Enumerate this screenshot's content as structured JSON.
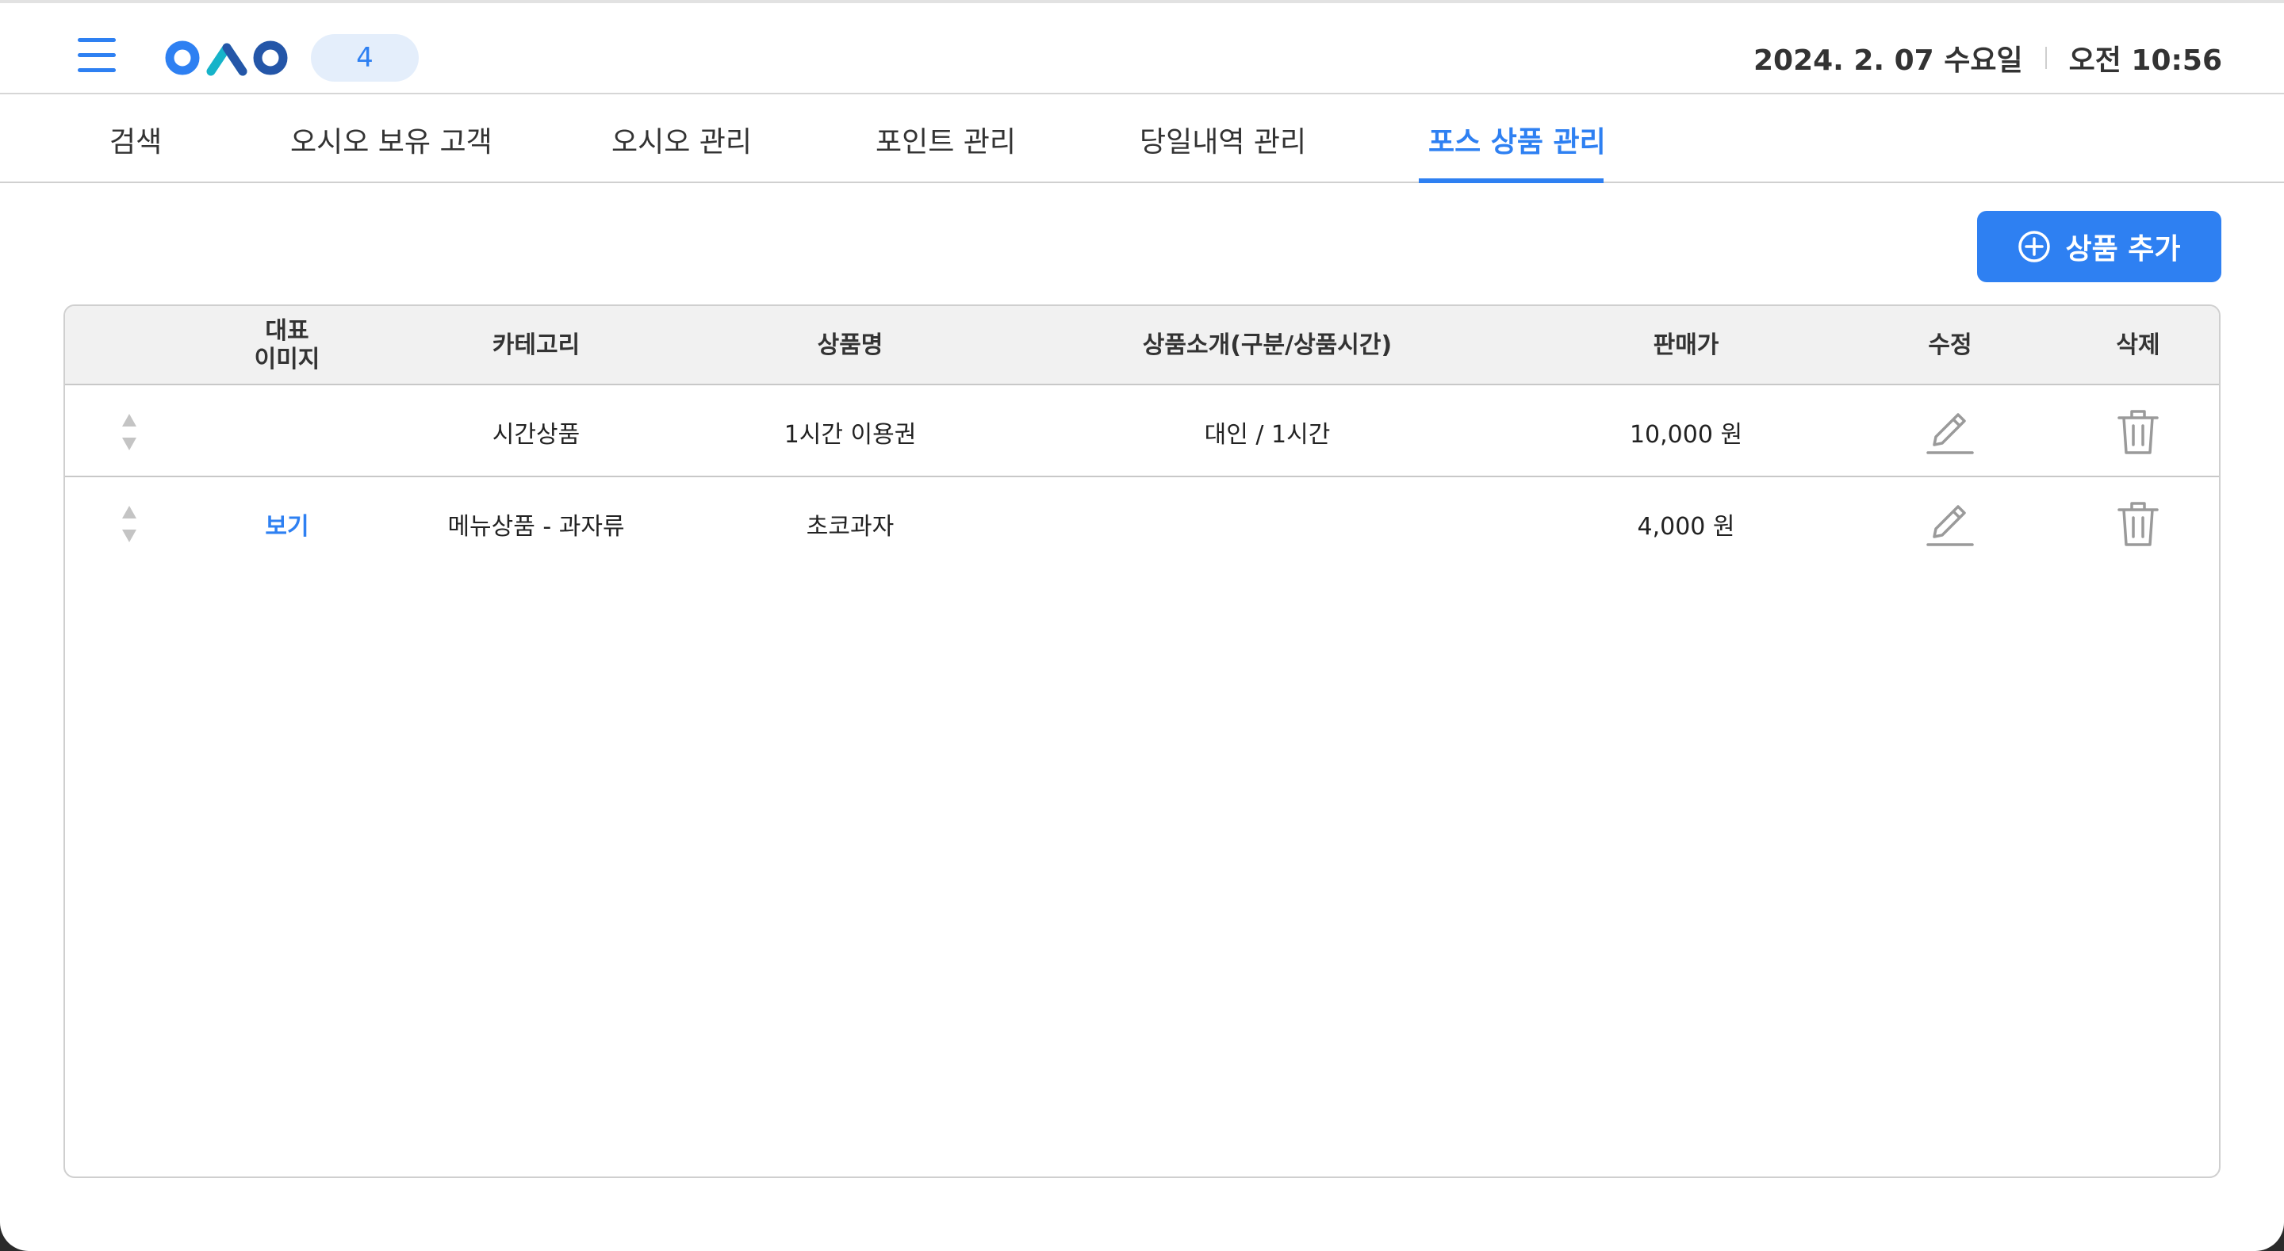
{
  "header": {
    "badge": "4",
    "date": "2024. 2. 07 수요일",
    "time": "오전 10:56",
    "logo_colors": [
      "#2e80f2",
      "#16b3c9",
      "#2456a8"
    ]
  },
  "tabs": [
    {
      "label": "검색"
    },
    {
      "label": "오시오 보유 고객"
    },
    {
      "label": "오시오 관리"
    },
    {
      "label": "포인트 관리"
    },
    {
      "label": "당일내역 관리"
    },
    {
      "label": "포스 상품 관리",
      "active": true
    }
  ],
  "toolbar": {
    "add_label": "상품 추가"
  },
  "table": {
    "headers": {
      "image_line1": "대표",
      "image_line2": "이미지",
      "category": "카테고리",
      "name": "상품명",
      "intro": "상품소개(구분/상품시간)",
      "price": "판매가",
      "edit": "수정",
      "delete": "삭제"
    },
    "rows": [
      {
        "image": "",
        "category": "시간상품",
        "name": "1시간 이용권",
        "intro": "대인 / 1시간",
        "price": "10,000 원"
      },
      {
        "image": "보기",
        "category": "메뉴상품 - 과자류",
        "name": "초코과자",
        "intro": "",
        "price": "4,000 원"
      }
    ]
  },
  "icons": {
    "menu": "hamburger-icon",
    "add": "plus-circle-icon",
    "edit": "pencil-icon",
    "delete": "trash-icon",
    "sort": "sort-arrows-icon"
  },
  "colors": {
    "accent": "#2e80f2",
    "header_bg": "#f1f1f1",
    "icon_gray": "#9a9a9a"
  }
}
